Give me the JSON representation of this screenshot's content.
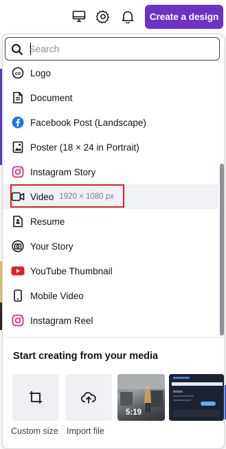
{
  "topbar": {
    "create_button": "Create a design",
    "icons": [
      "monitor-icon",
      "gear-icon",
      "bell-icon"
    ],
    "accent": "#6a32c9"
  },
  "search": {
    "placeholder": "Search",
    "value": ""
  },
  "design_types": [
    {
      "label": "Logo",
      "icon": "logo-icon"
    },
    {
      "label": "Document",
      "icon": "document-icon"
    },
    {
      "label": "Facebook Post (Landscape)",
      "icon": "facebook-icon"
    },
    {
      "label": "Poster (18 × 24 in Portrait)",
      "icon": "poster-icon"
    },
    {
      "label": "Instagram Story",
      "icon": "instagram-icon"
    },
    {
      "label": "Video",
      "dimensions": "1920 × 1080 px",
      "icon": "video-icon",
      "highlighted": true
    },
    {
      "label": "Resume",
      "icon": "resume-icon"
    },
    {
      "label": "Your Story",
      "icon": "camera-icon"
    },
    {
      "label": "YouTube Thumbnail",
      "icon": "youtube-icon"
    },
    {
      "label": "Mobile Video",
      "icon": "mobile-icon"
    },
    {
      "label": "Instagram Reel",
      "icon": "instagram-icon"
    }
  ],
  "media": {
    "title": "Start creating from your media",
    "custom_size": "Custom size",
    "import_file": "Import file",
    "thumb_duration": "5:19"
  },
  "colors": {
    "highlight_border": "#e01f26",
    "youtube_red": "#e01f26",
    "facebook_blue": "#1877f2"
  }
}
